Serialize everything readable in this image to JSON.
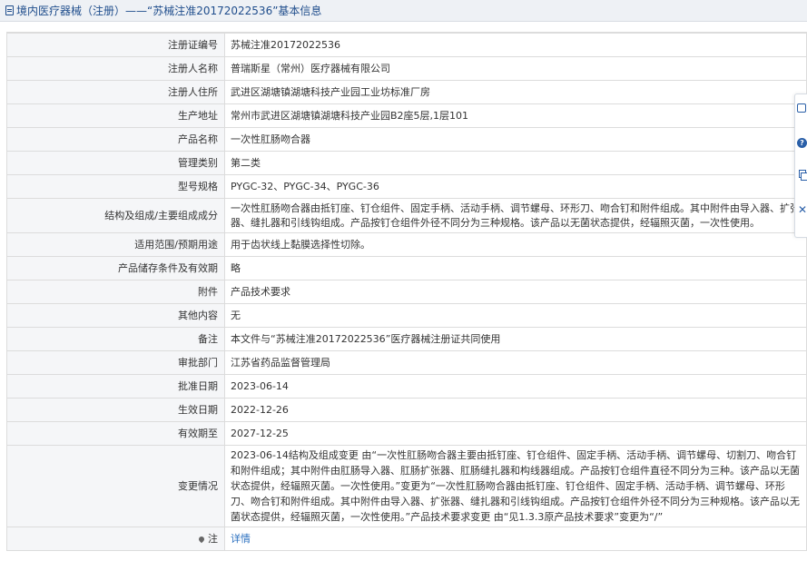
{
  "header": {
    "title": "境内医疗器械（注册）——“苏械注准20172022536”基本信息"
  },
  "rows": [
    {
      "label": "注册证编号",
      "value": "苏械注准20172022536"
    },
    {
      "label": "注册人名称",
      "value": "普瑞斯星（常州）医疗器械有限公司"
    },
    {
      "label": "注册人住所",
      "value": "武进区湖塘镇湖塘科技产业园工业坊标准厂房"
    },
    {
      "label": "生产地址",
      "value": "常州市武进区湖塘镇湖塘科技产业园B2座5层,1层101"
    },
    {
      "label": "产品名称",
      "value": "一次性肛肠吻合器"
    },
    {
      "label": "管理类别",
      "value": "第二类"
    },
    {
      "label": "型号规格",
      "value": "PYGC-32、PYGC-34、PYGC-36"
    },
    {
      "label": "结构及组成/主要组成成分",
      "value": "一次性肛肠吻合器由抵钉座、钉仓组件、固定手柄、活动手柄、调节螺母、环形刀、吻合钉和附件组成。其中附件由导入器、扩张器、缝扎器和引线钩组成。产品按钉仓组件外径不同分为三种规格。该产品以无菌状态提供，经辐照灭菌，一次性使用。"
    },
    {
      "label": "适用范围/预期用途",
      "value": "用于齿状线上黏膜选择性切除。"
    },
    {
      "label": "产品储存条件及有效期",
      "value": "略"
    },
    {
      "label": "附件",
      "value": "产品技术要求"
    },
    {
      "label": "其他内容",
      "value": "无"
    },
    {
      "label": "备注",
      "value": "本文件与“苏械注准20172022536”医疗器械注册证共同使用"
    },
    {
      "label": "审批部门",
      "value": "江苏省药品监督管理局"
    },
    {
      "label": "批准日期",
      "value": "2023-06-14"
    },
    {
      "label": "生效日期",
      "value": "2022-12-26"
    },
    {
      "label": "有效期至",
      "value": "2027-12-25"
    },
    {
      "label": "变更情况",
      "value": "2023-06-14结构及组成变更 由“一次性肛肠吻合器主要由抵钉座、钉仓组件、固定手柄、活动手柄、调节螺母、切割刀、吻合钉和附件组成；其中附件由肛肠导入器、肛肠扩张器、肛肠缝扎器和构线器组成。产品按钉仓组件直径不同分为三种。该产品以无菌状态提供，经辐照灭菌。一次性使用。”变更为“一次性肛肠吻合器由抵钉座、钉仓组件、固定手柄、活动手柄、调节螺母、环形刀、吻合钉和附件组成。其中附件由导入器、扩张器、缝扎器和引线钩组成。产品按钉仓组件外径不同分为三种规格。该产品以无菌状态提供，经辐照灭菌，一次性使用。”产品技术要求变更 由“见1.3.3原产品技术要求”变更为“/”"
    }
  ],
  "note": {
    "label": "注",
    "link_text": "详情"
  },
  "sidebar": {
    "icons": [
      "edit-icon",
      "help-icon",
      "copy-icon",
      "close-icon"
    ]
  }
}
